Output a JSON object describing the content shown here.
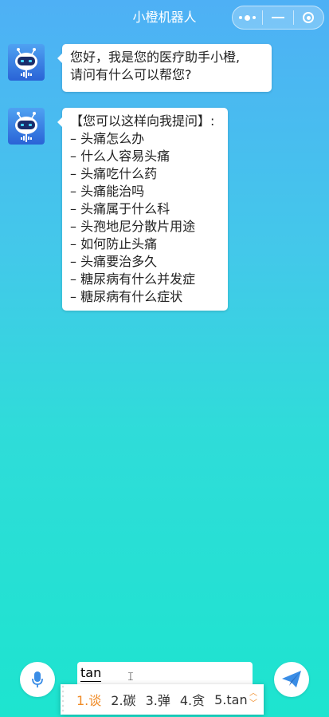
{
  "header": {
    "title": "小橙机器人"
  },
  "capsule": {
    "menu_icon": "more-dots-icon",
    "minimize_icon": "minimize-icon",
    "close_icon": "target-icon"
  },
  "messages": [
    {
      "sender": "bot",
      "avatar_icon": "robot-avatar-icon",
      "lines": [
        "您好，我是您的医疗助手小橙,",
        "请问有什么可以帮您?"
      ]
    },
    {
      "sender": "bot",
      "avatar_icon": "robot-avatar-icon",
      "lines": [
        "【您可以这样向我提问】:",
        "– 头痛怎么办",
        "– 什么人容易头痛",
        "– 头痛吃什么药",
        "– 头痛能治吗",
        "– 头痛属于什么科",
        "– 头孢地尼分散片用途",
        "– 如何防止头痛",
        "– 头痛要治多久",
        "– 糖尿病有什么并发症",
        "– 糖尿病有什么症状"
      ]
    }
  ],
  "input": {
    "value": "tan",
    "mic_icon": "microphone-icon",
    "send_icon": "send-icon"
  },
  "ime": {
    "candidates": [
      "1.谈",
      "2.碳",
      "3.弹",
      "4.贪",
      "5.tan"
    ],
    "selected_index": 0,
    "accent_color": "#f08a24"
  }
}
